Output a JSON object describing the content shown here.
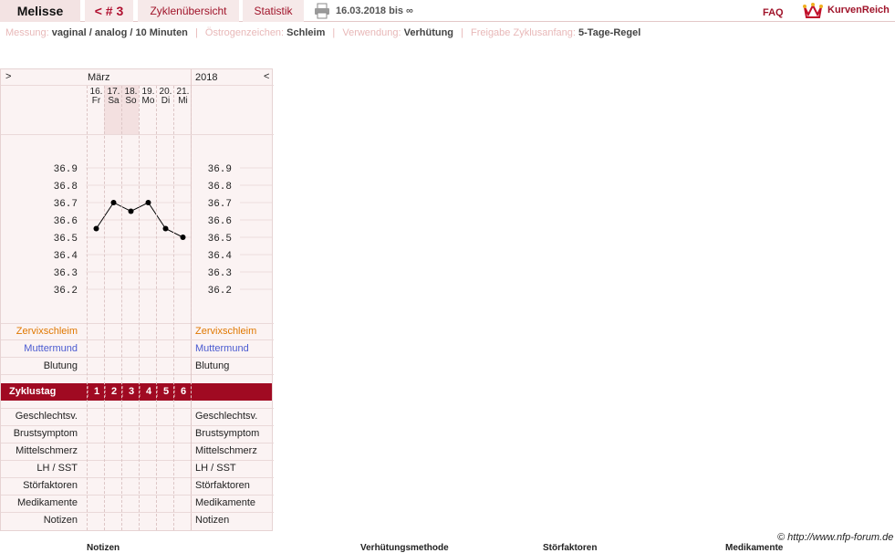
{
  "header": {
    "user": "Melisse",
    "cycle": "< # 3",
    "tabs": {
      "overview": "Zyklenübersicht",
      "stats": "Statistik"
    },
    "date_range": "16.03.2018 bis ∞",
    "faq": "FAQ",
    "logo_text": "KurvenReich"
  },
  "meta": [
    {
      "key": "Messung:",
      "value": "vaginal / analog / 10 Minuten"
    },
    {
      "key": "Östrogenzeichen:",
      "value": "Schleim"
    },
    {
      "key": "Verwendung:",
      "value": "Verhütung"
    },
    {
      "key": "Freigabe Zyklusanfang:",
      "value": "5-Tage-Regel"
    }
  ],
  "chart": {
    "nav_next": ">",
    "nav_prev": "<",
    "month": "März",
    "year": "2018",
    "days": [
      {
        "date": "16.",
        "dow": "Fr",
        "cycle_day": "1"
      },
      {
        "date": "17.",
        "dow": "Sa",
        "cycle_day": "2"
      },
      {
        "date": "18.",
        "dow": "So",
        "cycle_day": "3"
      },
      {
        "date": "19.",
        "dow": "Mo",
        "cycle_day": "4"
      },
      {
        "date": "20.",
        "dow": "Di",
        "cycle_day": "5"
      },
      {
        "date": "21.",
        "dow": "Mi",
        "cycle_day": "6"
      }
    ],
    "temp_scale": [
      "36.9",
      "36.8",
      "36.7",
      "36.6",
      "36.5",
      "36.4",
      "36.3",
      "36.2"
    ],
    "zyklustag_label": "Zyklustag",
    "rows_top": [
      "Zervixschleim",
      "Muttermund",
      "Blutung"
    ],
    "rows_bottom": [
      "Geschlechtsv.",
      "Brustsymptom",
      "Mittelschmerz",
      "LH / SST",
      "Störfaktoren",
      "Medikamente",
      "Notizen"
    ]
  },
  "chart_data": {
    "type": "line",
    "x": [
      "16.",
      "17.",
      "18.",
      "19.",
      "20.",
      "21."
    ],
    "series": [
      {
        "values": [
          36.55,
          36.7,
          36.65,
          36.7,
          36.55,
          36.5
        ]
      }
    ],
    "ylim": [
      36.2,
      36.9
    ]
  },
  "colors": {
    "accent": "#a00a22",
    "cervix": "#e07800",
    "cervix_pos": "#4a5ad0"
  },
  "footer": {
    "copyright": "© http://www.nfp-forum.de",
    "headers": [
      "Notizen",
      "Verhütungsmethode",
      "Störfaktoren",
      "Medikamente"
    ]
  }
}
